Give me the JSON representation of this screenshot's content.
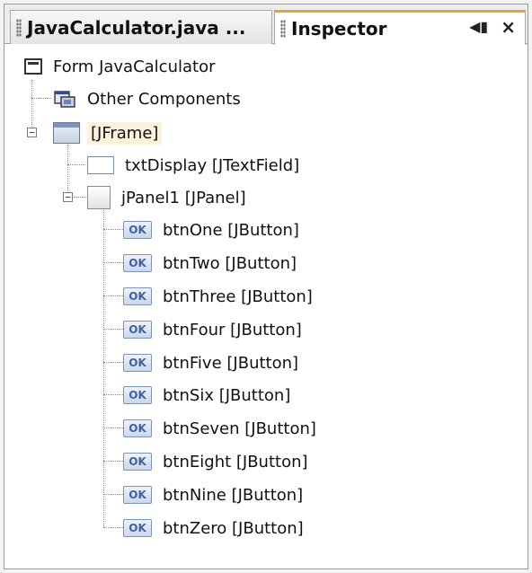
{
  "tabs": [
    {
      "label": "JavaCalculator.java ...",
      "active": false
    },
    {
      "label": "Inspector",
      "active": true
    }
  ],
  "tab_controls": {
    "restore_glyph": "◀▮",
    "close_glyph": "×"
  },
  "tree": {
    "root": {
      "label": "Form JavaCalculator",
      "icon": "form-icon"
    },
    "other": {
      "label": "Other Components",
      "icon": "components-icon"
    },
    "frame": {
      "label": "[JFrame]",
      "icon": "frame-icon",
      "expanded": true
    },
    "txt": {
      "label": "txtDisplay [JTextField]",
      "icon": "textfield-icon"
    },
    "panel": {
      "label": "jPanel1 [JPanel]",
      "icon": "panel-icon",
      "expanded": true
    },
    "buttons": [
      {
        "label": "btnOne [JButton]"
      },
      {
        "label": "btnTwo [JButton]"
      },
      {
        "label": "btnThree [JButton]"
      },
      {
        "label": "btnFour [JButton]"
      },
      {
        "label": "btnFive [JButton]"
      },
      {
        "label": "btnSix [JButton]"
      },
      {
        "label": "btnSeven [JButton]"
      },
      {
        "label": "btnEight [JButton]"
      },
      {
        "label": "btnNine [JButton]"
      },
      {
        "label": "btnZero [JButton]"
      }
    ],
    "button_icon_text": "OK"
  },
  "colors": {
    "active_tab_accent": "#f0a030",
    "selection_highlight": "#fbf2dc"
  }
}
